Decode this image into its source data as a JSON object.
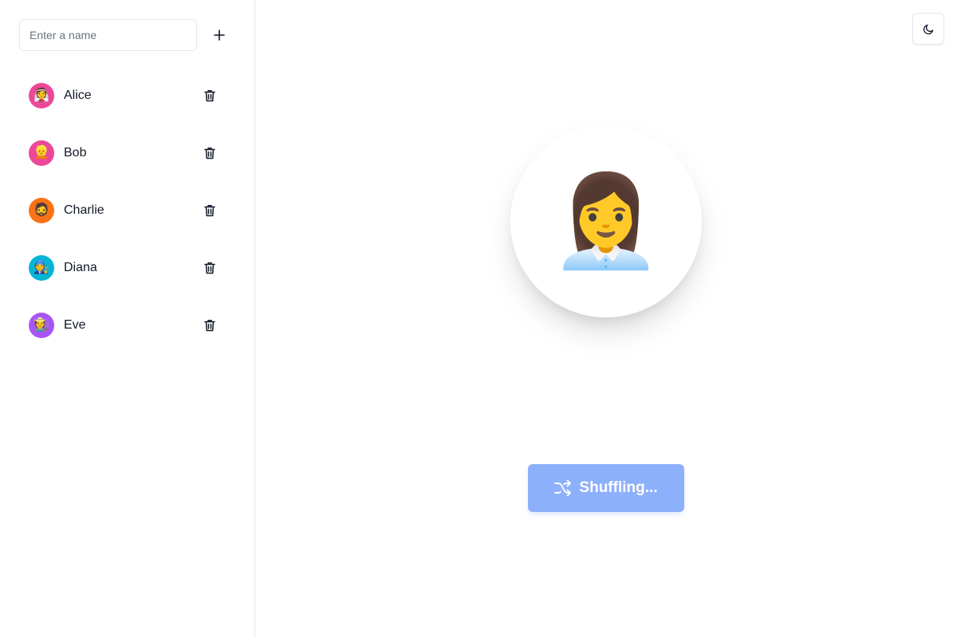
{
  "sidebar": {
    "input": {
      "placeholder": "Enter a name",
      "value": ""
    },
    "add_icon": "plus-icon",
    "people": [
      {
        "name": "Alice",
        "emoji": "👰",
        "color": "#ec4899"
      },
      {
        "name": "Bob",
        "emoji": "👱",
        "color": "#ec4899"
      },
      {
        "name": "Charlie",
        "emoji": "🧔",
        "color": "#f97316"
      },
      {
        "name": "Diana",
        "emoji": "🧑‍🔧",
        "color": "#06b6d4"
      },
      {
        "name": "Eve",
        "emoji": "🧑‍🌾",
        "color": "#a855f7"
      }
    ],
    "delete_icon": "trash-icon"
  },
  "header": {
    "theme_toggle_icon": "moon-icon"
  },
  "main": {
    "selected_emoji": "👩‍💼",
    "shuffle_button": {
      "label": "Shuffling...",
      "icon": "shuffle-icon",
      "color": "#8db0fb",
      "disabled": true
    }
  }
}
